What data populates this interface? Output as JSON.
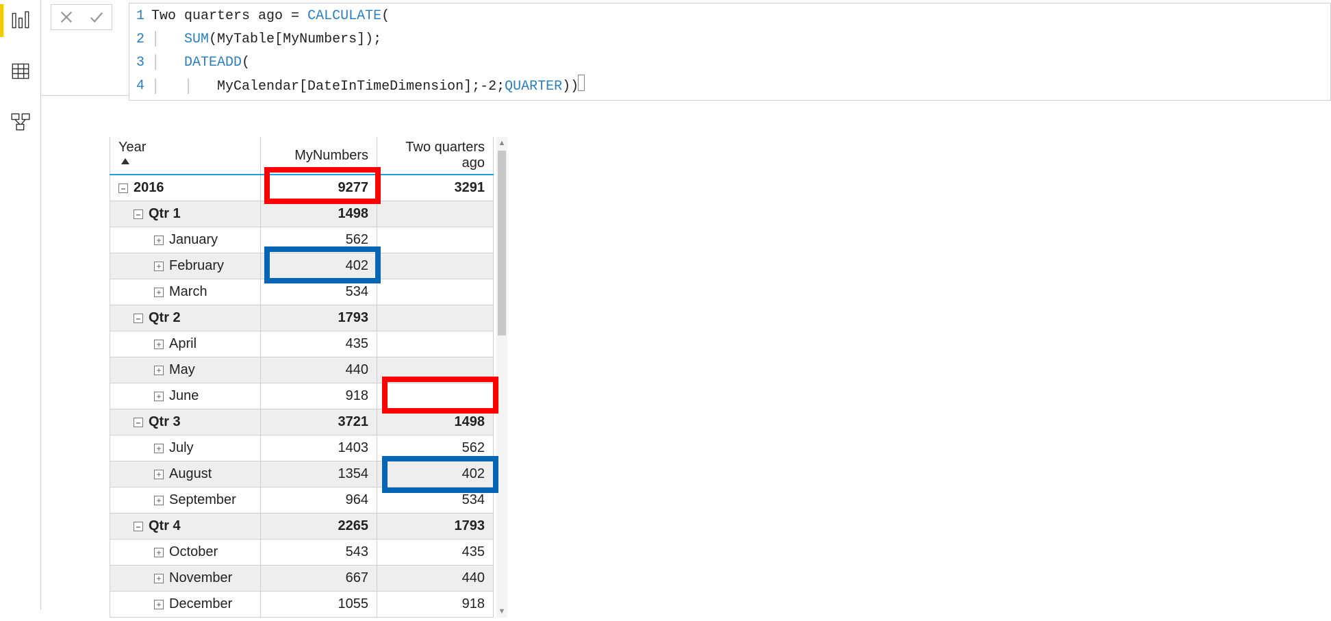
{
  "sidebar": {
    "icons": [
      "report-view-icon",
      "data-view-icon",
      "model-view-icon"
    ]
  },
  "formula": {
    "lines": [
      {
        "num": "1",
        "prefix": "Two quarters ago = ",
        "fn": "CALCULATE",
        "suffix1": "("
      },
      {
        "num": "2",
        "indent": "    ",
        "fn": "SUM",
        "suffix": "(MyTable[MyNumbers]);"
      },
      {
        "num": "3",
        "indent": "    ",
        "fn": "DATEADD",
        "suffix": "("
      },
      {
        "num": "4",
        "indent": "        ",
        "mid": "MyCalendar[DateInTimeDimension];-2;",
        "fn": "QUARTER",
        "suffix": "))"
      }
    ]
  },
  "matrix": {
    "headers": {
      "year": "Year",
      "col1": "MyNumbers",
      "col2": "Two quarters ago"
    },
    "rows": [
      {
        "lvl": 0,
        "shade": false,
        "bold": true,
        "ic": "–",
        "label": "2016",
        "c1": "9277",
        "c2": "3291"
      },
      {
        "lvl": 1,
        "shade": true,
        "bold": true,
        "ic": "–",
        "label": "Qtr 1",
        "c1": "1498",
        "c2": ""
      },
      {
        "lvl": 2,
        "shade": false,
        "bold": false,
        "ic": "+",
        "label": "January",
        "c1": "562",
        "c2": ""
      },
      {
        "lvl": 2,
        "shade": true,
        "bold": false,
        "ic": "+",
        "label": "February",
        "c1": "402",
        "c2": ""
      },
      {
        "lvl": 2,
        "shade": false,
        "bold": false,
        "ic": "+",
        "label": "March",
        "c1": "534",
        "c2": ""
      },
      {
        "lvl": 1,
        "shade": true,
        "bold": true,
        "ic": "–",
        "label": "Qtr 2",
        "c1": "1793",
        "c2": ""
      },
      {
        "lvl": 2,
        "shade": false,
        "bold": false,
        "ic": "+",
        "label": "April",
        "c1": "435",
        "c2": ""
      },
      {
        "lvl": 2,
        "shade": true,
        "bold": false,
        "ic": "+",
        "label": "May",
        "c1": "440",
        "c2": ""
      },
      {
        "lvl": 2,
        "shade": false,
        "bold": false,
        "ic": "+",
        "label": "June",
        "c1": "918",
        "c2": ""
      },
      {
        "lvl": 1,
        "shade": true,
        "bold": true,
        "ic": "–",
        "label": "Qtr 3",
        "c1": "3721",
        "c2": "1498"
      },
      {
        "lvl": 2,
        "shade": false,
        "bold": false,
        "ic": "+",
        "label": "July",
        "c1": "1403",
        "c2": "562"
      },
      {
        "lvl": 2,
        "shade": true,
        "bold": false,
        "ic": "+",
        "label": "August",
        "c1": "1354",
        "c2": "402"
      },
      {
        "lvl": 2,
        "shade": false,
        "bold": false,
        "ic": "+",
        "label": "September",
        "c1": "964",
        "c2": "534"
      },
      {
        "lvl": 1,
        "shade": true,
        "bold": true,
        "ic": "–",
        "label": "Qtr 4",
        "c1": "2265",
        "c2": "1793"
      },
      {
        "lvl": 2,
        "shade": false,
        "bold": false,
        "ic": "+",
        "label": "October",
        "c1": "543",
        "c2": "435"
      },
      {
        "lvl": 2,
        "shade": true,
        "bold": false,
        "ic": "+",
        "label": "November",
        "c1": "667",
        "c2": "440"
      },
      {
        "lvl": 2,
        "shade": false,
        "bold": false,
        "ic": "+",
        "label": "December",
        "c1": "1055",
        "c2": "918"
      }
    ]
  }
}
